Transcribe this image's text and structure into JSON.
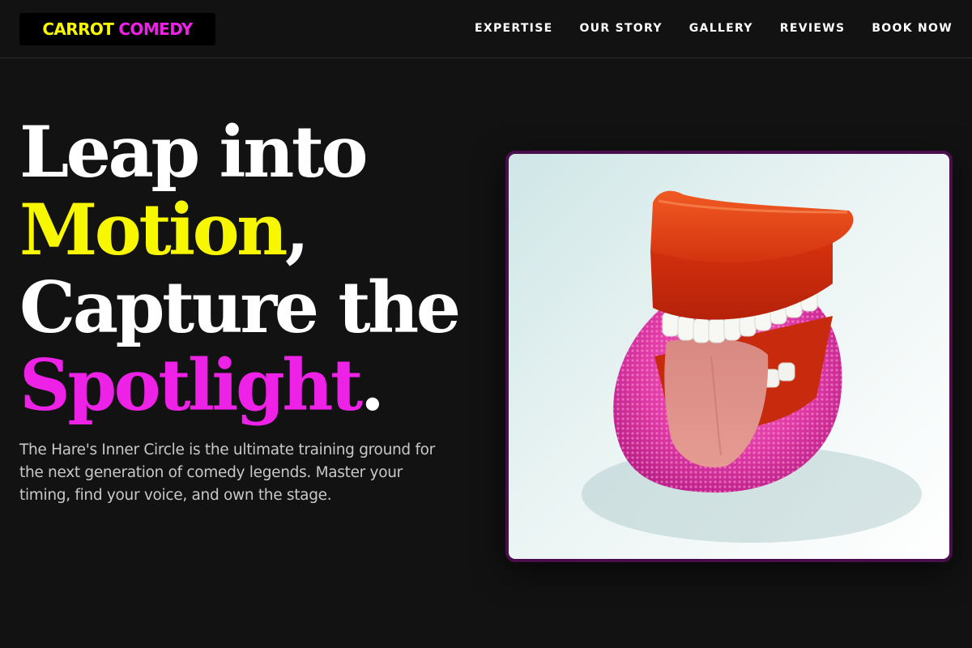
{
  "brand": {
    "part1": "CARROT",
    "part2": "COMEDY"
  },
  "nav": {
    "items": [
      "EXPERTISE",
      "OUR STORY",
      "GALLERY",
      "REVIEWS",
      "BOOK NOW"
    ]
  },
  "hero": {
    "line1": "Leap into",
    "line2_highlight": "Motion",
    "line2_punct": ",",
    "line3": "Capture the",
    "line4_highlight": "Spotlight",
    "line4_punct": ".",
    "description": "The Hare's Inner Circle is the ultimate training ground for the next generation of comedy legends. Master your timing, find your voice, and own the stage."
  },
  "colors": {
    "background": "#121212",
    "accent_yellow": "#f7f700",
    "accent_magenta": "#ee22e6",
    "frame_border": "#4a0e4c"
  },
  "image": {
    "subject": "wind-up chattering teeth toy with tongue on a pink sponge"
  }
}
